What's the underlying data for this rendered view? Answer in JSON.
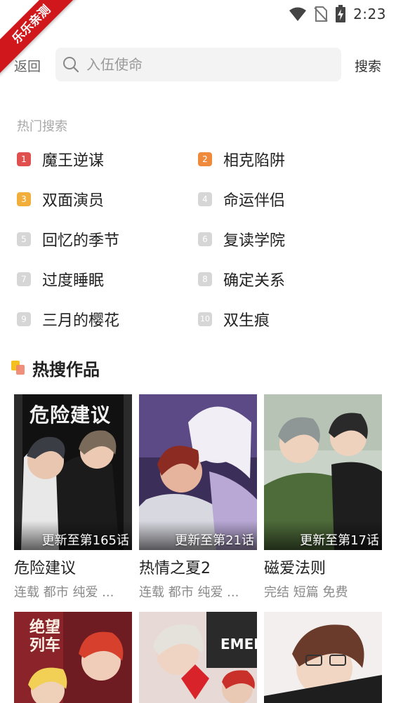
{
  "status_bar": {
    "time": "2:23",
    "watermark": "乐乐亲测"
  },
  "search": {
    "back_label": "返回",
    "placeholder": "入伍使命",
    "submit_label": "搜索"
  },
  "hot_search": {
    "title": "热门搜索",
    "items": [
      {
        "rank": "1",
        "label": "魔王逆谋",
        "color": "#e0504f"
      },
      {
        "rank": "2",
        "label": "相克陷阱",
        "color": "#ef8a3d"
      },
      {
        "rank": "3",
        "label": "双面演员",
        "color": "#f1ae3a"
      },
      {
        "rank": "4",
        "label": "命运伴侣",
        "color": "#d6d6d6"
      },
      {
        "rank": "5",
        "label": "回忆的季节",
        "color": "#d6d6d6"
      },
      {
        "rank": "6",
        "label": "复读学院",
        "color": "#d6d6d6"
      },
      {
        "rank": "7",
        "label": "过度睡眠",
        "color": "#d6d6d6"
      },
      {
        "rank": "8",
        "label": "确定关系",
        "color": "#d6d6d6"
      },
      {
        "rank": "9",
        "label": "三月的樱花",
        "color": "#d6d6d6"
      },
      {
        "rank": "10",
        "label": "双生痕",
        "color": "#d6d6d6"
      }
    ]
  },
  "hot_works": {
    "title": "热搜作品",
    "cards": [
      {
        "title": "危险建议",
        "update": "更新至第165话",
        "tags": "连载 都市 纯爱 ...",
        "cover_text": "危险建议"
      },
      {
        "title": "热情之夏2",
        "update": "更新至第21话",
        "tags": "连载 都市 纯爱 ...",
        "cover_text": ""
      },
      {
        "title": "磁爱法则",
        "update": "更新至第17话",
        "tags": "完结 短篇 免费",
        "cover_text": ""
      },
      {
        "title": "",
        "update": "",
        "tags": "",
        "cover_text": "绝望列车"
      },
      {
        "title": "",
        "update": "",
        "tags": "",
        "cover_text": "EMER"
      },
      {
        "title": "",
        "update": "",
        "tags": "",
        "cover_text": ""
      }
    ]
  }
}
